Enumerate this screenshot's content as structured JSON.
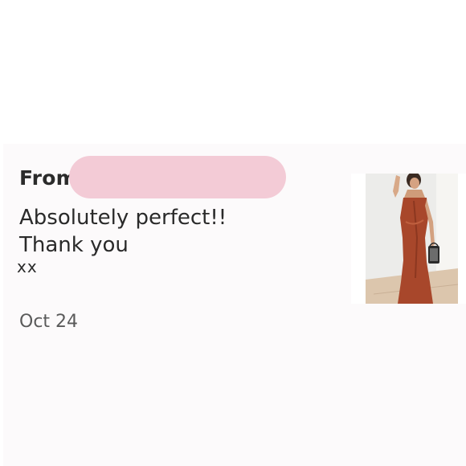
{
  "review": {
    "from_label": "From",
    "message_lines": [
      "Absolutely perfect!!",
      "Thank you"
    ],
    "signoff": "xx",
    "date": "Oct 24"
  },
  "colors": {
    "redaction": "#f3cbd6",
    "dress": "#a8472b",
    "text": "#2b2b2b",
    "date_text": "#5a5a5a"
  },
  "icons": {
    "product_photo": "woman-in-rust-satin-dress-photo"
  }
}
